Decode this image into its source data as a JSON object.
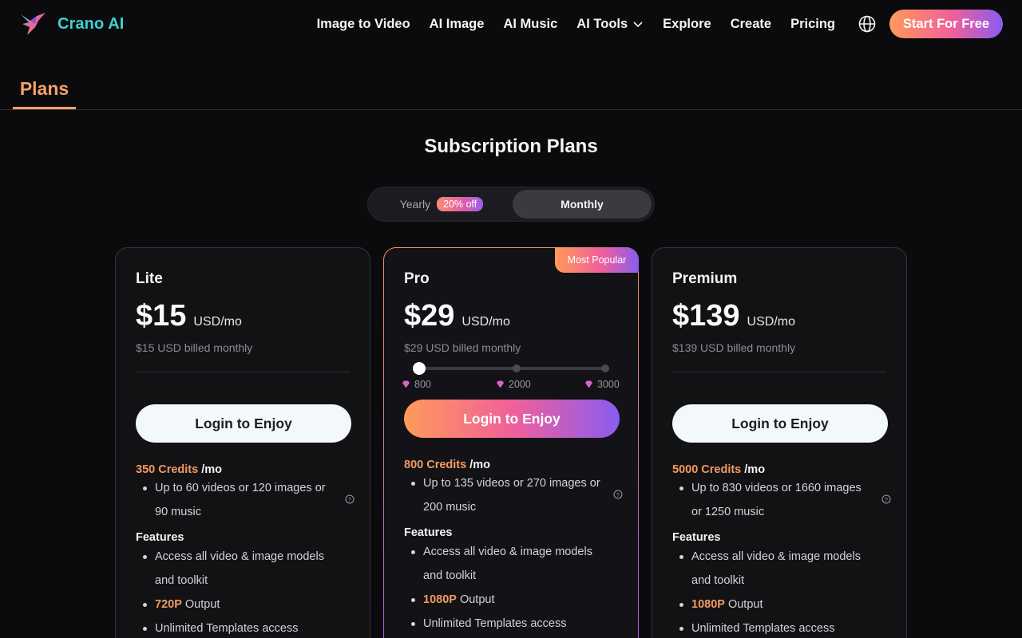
{
  "brand": {
    "name": "Crano AI"
  },
  "nav": {
    "items": [
      {
        "label": "Image to Video"
      },
      {
        "label": "AI Image"
      },
      {
        "label": "AI Music"
      },
      {
        "label": "AI Tools"
      },
      {
        "label": "Explore"
      },
      {
        "label": "Create"
      },
      {
        "label": "Pricing"
      }
    ],
    "cta": "Start For Free",
    "icons": [
      "chevron-down-icon",
      "globe-icon"
    ]
  },
  "tabs": {
    "plans": "Plans"
  },
  "section_title": "Subscription Plans",
  "billing": {
    "yearly": "Yearly",
    "discount": "20% off",
    "monthly": "Monthly",
    "selected": "Monthly"
  },
  "colors": {
    "accent": "#f39a62",
    "gradient_start": "#ff9a5a",
    "gradient_mid": "#f0609a",
    "gradient_end": "#8a5cf0",
    "brand": "#3fd0d4"
  },
  "plans": [
    {
      "name": "Lite",
      "price": "$15",
      "unit": "USD/mo",
      "billed": "$15 USD billed monthly",
      "button": "Login to Enjoy",
      "credits": "350 Credits",
      "credits_period": "/mo",
      "usage": "Up to 60 videos or 120 images or 90 music",
      "features_title": "Features",
      "feature_1": "Access all video & image models and toolkit",
      "output_res": "720P",
      "output_label": "Output",
      "feature_3": "Unlimited Templates access"
    },
    {
      "name": "Pro",
      "badge": "Most Popular",
      "price": "$29",
      "unit": "USD/mo",
      "billed": "$29 USD billed monthly",
      "slider": {
        "options": [
          "800",
          "2000",
          "3000"
        ],
        "selected": "800"
      },
      "button": "Login to Enjoy",
      "credits": "800 Credits",
      "credits_period": "/mo",
      "usage": "Up to 135 videos or 270 images or 200 music",
      "features_title": "Features",
      "feature_1": "Access all video & image models and toolkit",
      "output_res": "1080P",
      "output_label": "Output",
      "feature_3": "Unlimited Templates access"
    },
    {
      "name": "Premium",
      "price": "$139",
      "unit": "USD/mo",
      "billed": "$139 USD billed monthly",
      "button": "Login to Enjoy",
      "credits": "5000 Credits",
      "credits_period": "/mo",
      "usage": "Up to 830 videos or 1660 images or 1250 music",
      "features_title": "Features",
      "feature_1": "Access all video & image models and toolkit",
      "output_res": "1080P",
      "output_label": "Output",
      "feature_3": "Unlimited Templates access"
    }
  ]
}
